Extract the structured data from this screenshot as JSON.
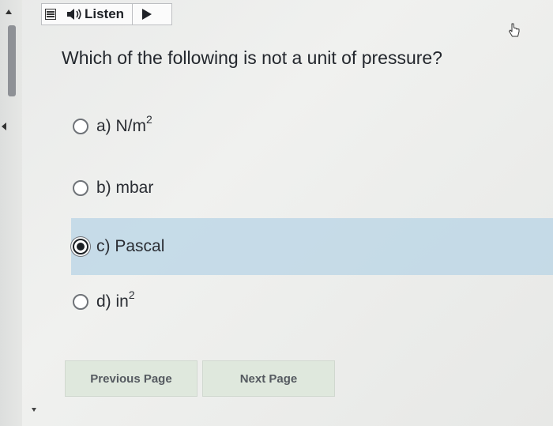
{
  "toolbar": {
    "menu_icon": "menu-icon",
    "speaker_icon": "speaker-icon",
    "listen_label": "Listen",
    "play_icon": "play-icon"
  },
  "question": {
    "text": "Which of the following is not a unit of pressure?"
  },
  "answers": [
    {
      "prefix": "a) N/m",
      "sup": "2",
      "selected": false
    },
    {
      "prefix": "b) mbar",
      "sup": "",
      "selected": false
    },
    {
      "prefix": "c) Pascal",
      "sup": "",
      "selected": true
    },
    {
      "prefix": "d) in",
      "sup": "2",
      "selected": false
    }
  ],
  "navigation": {
    "previous_label": "Previous Page",
    "next_label": "Next Page"
  },
  "colors": {
    "selected_row": "#b8d4e6",
    "nav_button_bg": "#dfe8dd"
  }
}
